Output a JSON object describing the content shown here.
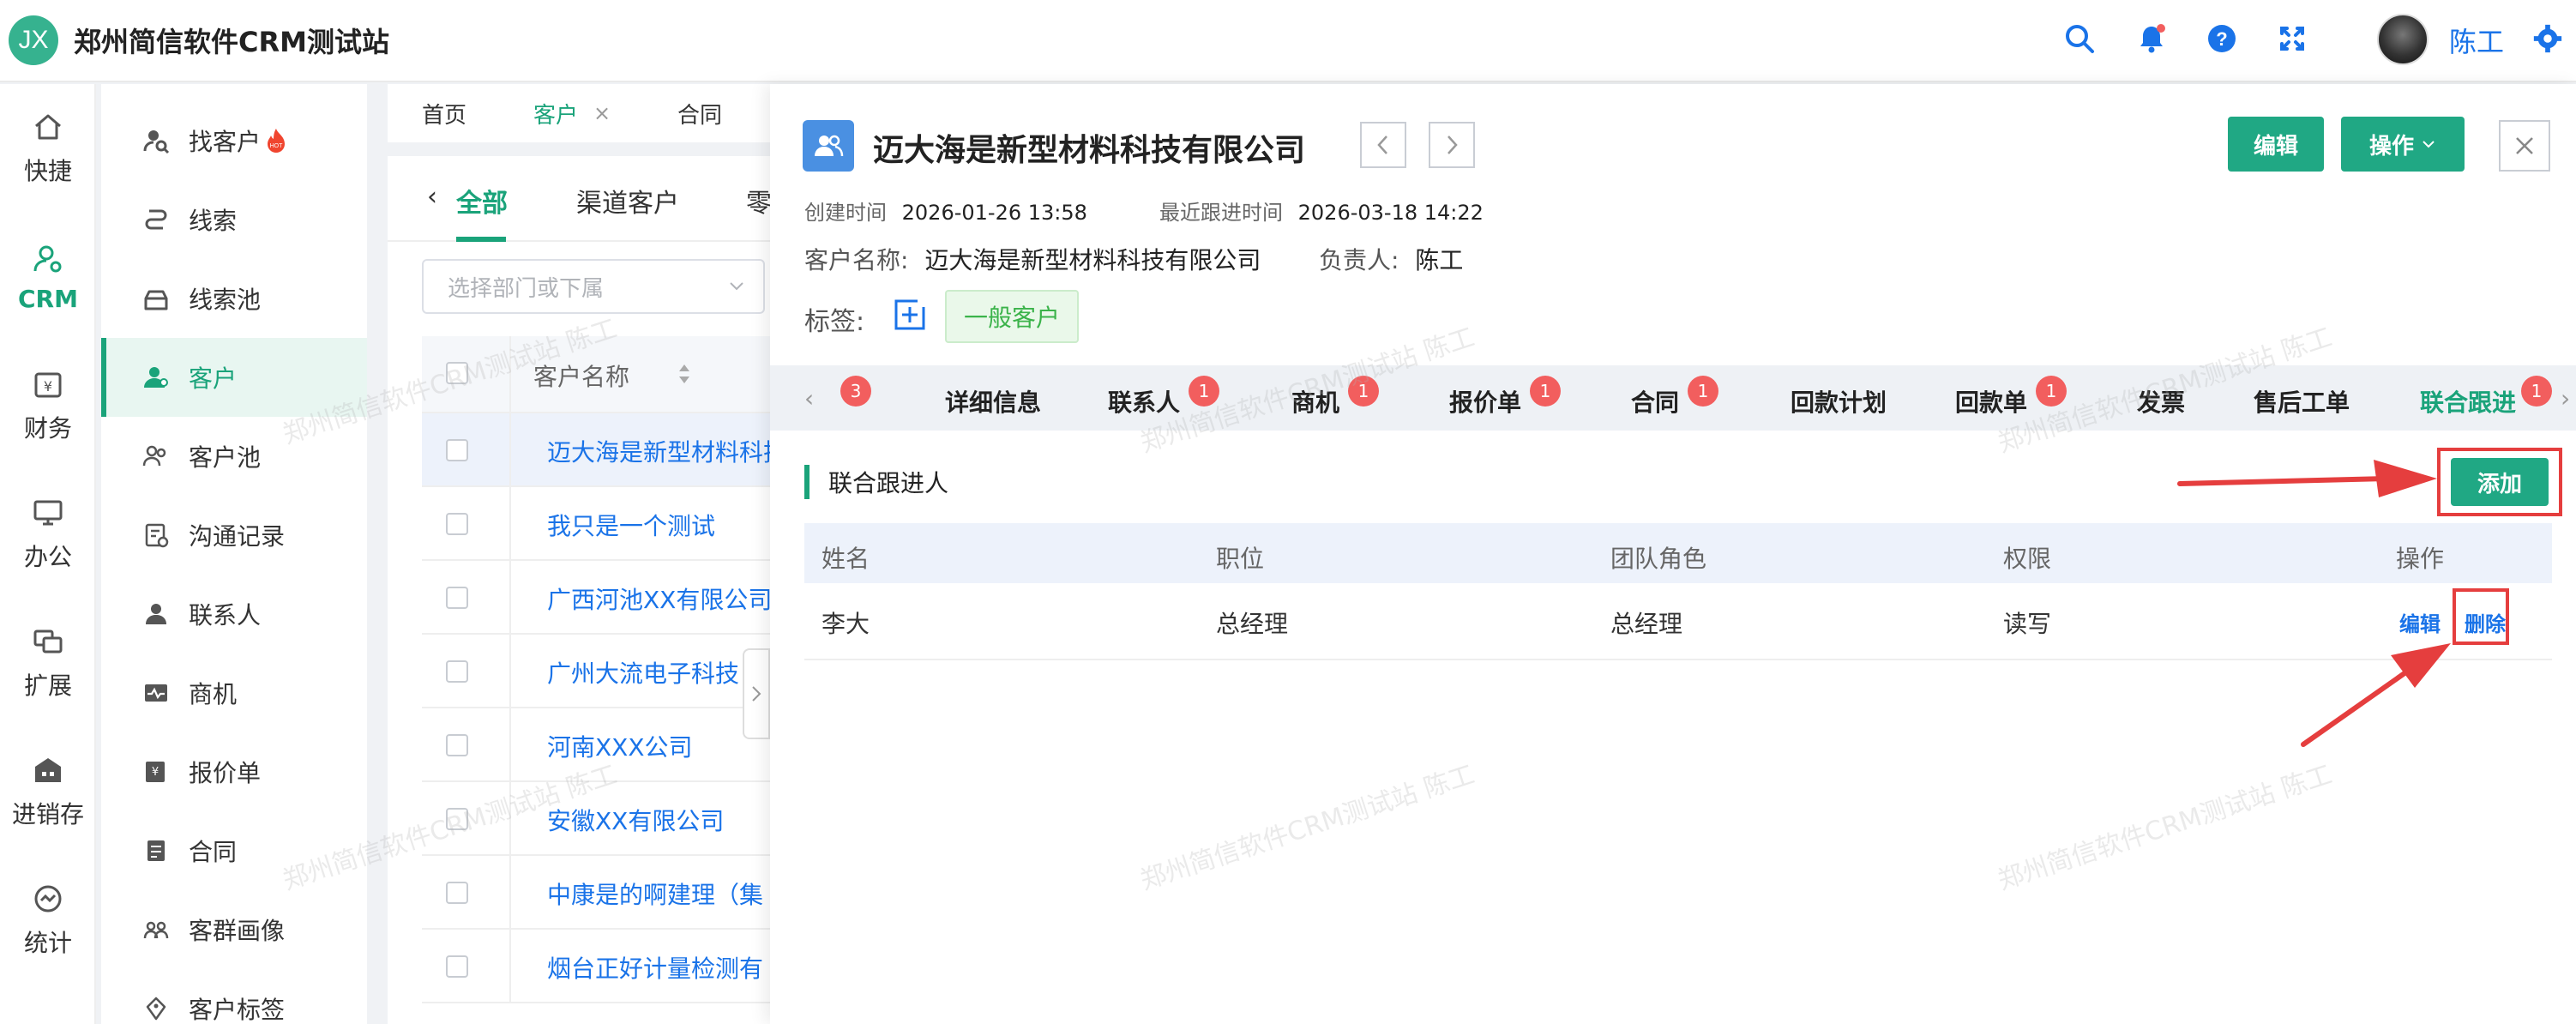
{
  "app": {
    "logo_text": "JX",
    "title": "郑州简信软件CRM测试站",
    "user_name": "陈工"
  },
  "rail": [
    {
      "label": "快捷",
      "icon": "home-icon"
    },
    {
      "label": "CRM",
      "icon": "crm-user-icon"
    },
    {
      "label": "财务",
      "icon": "finance-icon"
    },
    {
      "label": "办公",
      "icon": "monitor-icon"
    },
    {
      "label": "扩展",
      "icon": "extend-icon"
    },
    {
      "label": "进销存",
      "icon": "warehouse-icon"
    },
    {
      "label": "统计",
      "icon": "stats-icon"
    }
  ],
  "submenu": [
    {
      "label": "找客户",
      "icon": "find-customer-icon"
    },
    {
      "label": "线索",
      "icon": "lead-icon"
    },
    {
      "label": "线索池",
      "icon": "lead-pool-icon"
    },
    {
      "label": "客户",
      "icon": "customer-icon"
    },
    {
      "label": "客户池",
      "icon": "customer-pool-icon"
    },
    {
      "label": "沟通记录",
      "icon": "record-icon"
    },
    {
      "label": "联系人",
      "icon": "contact-icon"
    },
    {
      "label": "商机",
      "icon": "opportunity-icon"
    },
    {
      "label": "报价单",
      "icon": "quote-icon"
    },
    {
      "label": "合同",
      "icon": "contract-icon"
    },
    {
      "label": "客群画像",
      "icon": "group-icon"
    },
    {
      "label": "客户标签",
      "icon": "tag-icon"
    }
  ],
  "tabs": {
    "home": "首页",
    "customer": "客户",
    "contract": "合同"
  },
  "list": {
    "cat_all": "全部",
    "cat_channel": "渠道客户",
    "cat_more": "零",
    "dept_placeholder": "选择部门或下属",
    "col_name": "客户名称",
    "rows": [
      "迈大海是新型材料科技有限公司",
      "我只是一个测试",
      "广西河池XX有限公司",
      "广州大流电子科技",
      "河南XXX公司",
      "安徽XX有限公司",
      "中康是的啊建理（集",
      "烟台正好计量检测有"
    ]
  },
  "detail": {
    "title": "迈大海是新型材料科技有限公司",
    "edit_label": "编辑",
    "ops_label": "操作",
    "created_label": "创建时间",
    "created_value": "2026-01-26 13:58",
    "followup_label": "最近跟进时间",
    "followup_value": "2026-03-18 14:22",
    "customer_name_label": "客户名称:",
    "customer_name_value": "迈大海是新型材料科技有限公司",
    "owner_label": "负责人:",
    "owner_value": "陈工",
    "tags_label": "标签:",
    "tag_chip": "一般客户",
    "left_badge": "3",
    "sub_tabs": [
      {
        "label": "详细信息",
        "badge": ""
      },
      {
        "label": "联系人",
        "badge": "1"
      },
      {
        "label": "商机",
        "badge": "1"
      },
      {
        "label": "报价单",
        "badge": "1"
      },
      {
        "label": "合同",
        "badge": "1"
      },
      {
        "label": "回款计划",
        "badge": ""
      },
      {
        "label": "回款单",
        "badge": "1"
      },
      {
        "label": "发票",
        "badge": ""
      },
      {
        "label": "售后工单",
        "badge": ""
      },
      {
        "label": "联合跟进",
        "badge": "1"
      }
    ],
    "section_title": "联合跟进人",
    "add_label": "添加",
    "table_head": {
      "name": "姓名",
      "position": "职位",
      "role": "团队角色",
      "permission": "权限",
      "ops": "操作"
    },
    "rows": [
      {
        "name": "李大",
        "position": "总经理",
        "role": "总经理",
        "permission": "读写",
        "edit": "编辑",
        "delete": "删除"
      }
    ]
  },
  "watermark": "郑州简信软件CRM测试站 陈工",
  "colors": {
    "brand_green": "#20a884",
    "link_blue": "#1a73e8",
    "badge_red": "#f25e5e",
    "highlight_red": "#e53e3e"
  }
}
